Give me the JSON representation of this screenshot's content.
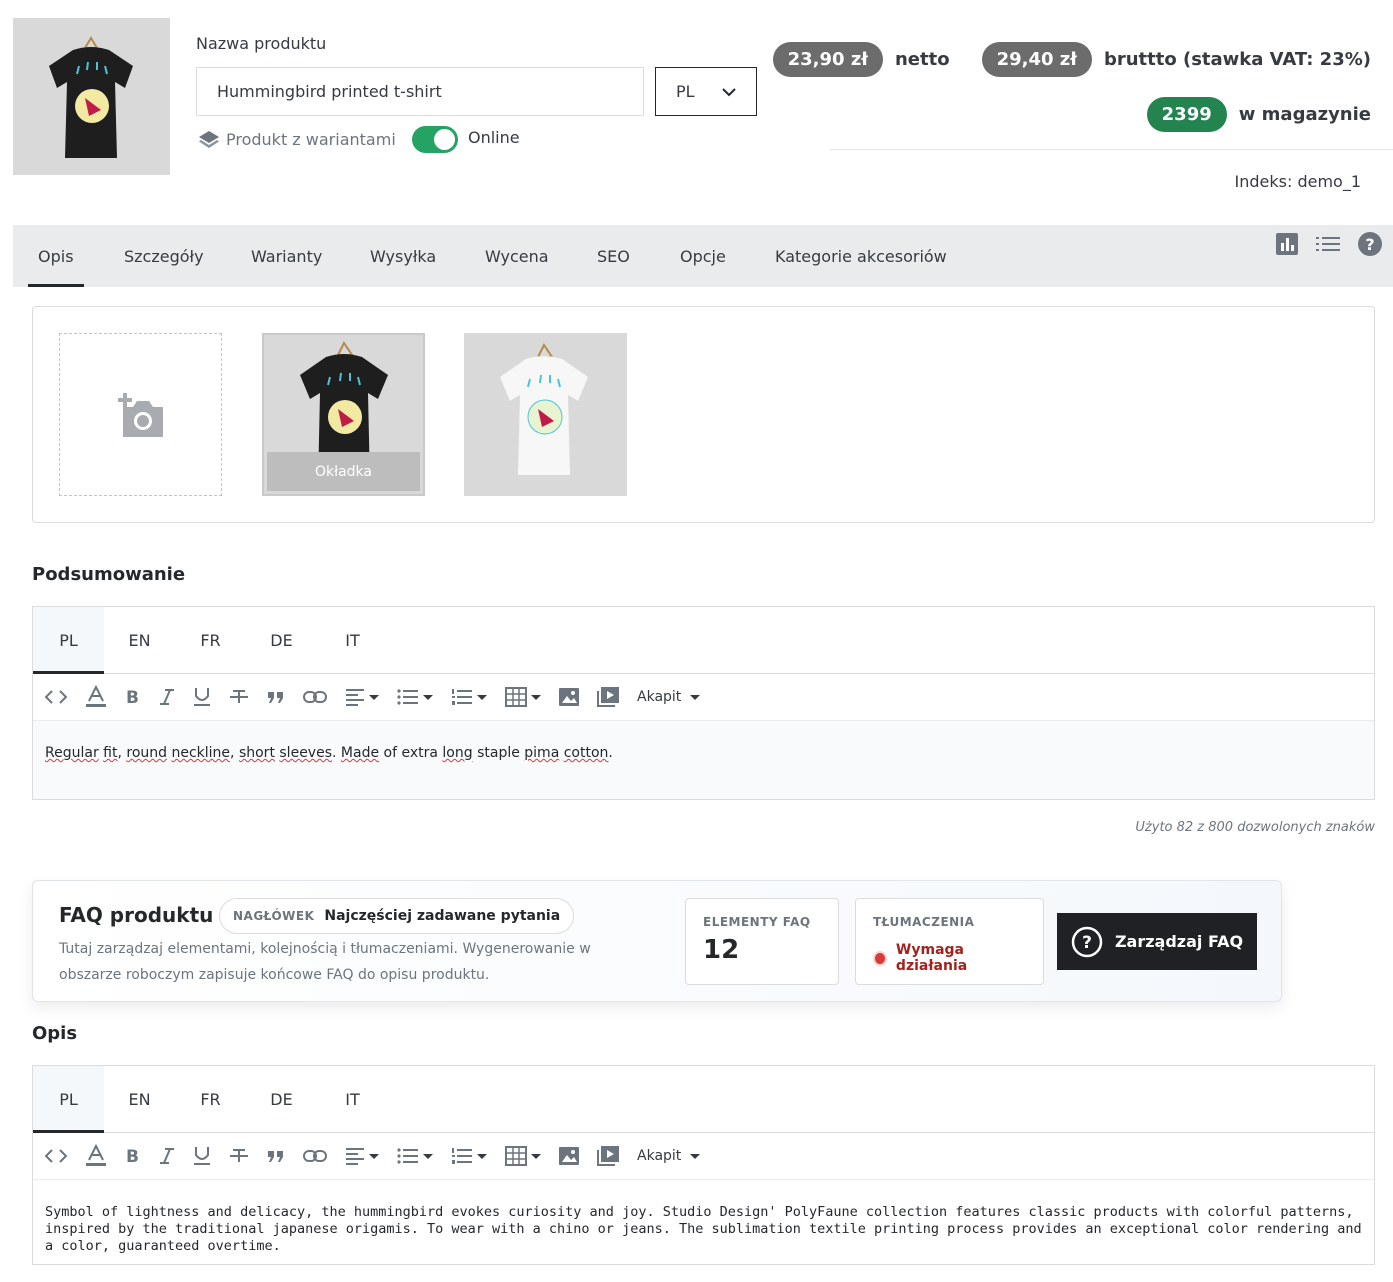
{
  "product": {
    "name_label": "Nazwa produktu",
    "name_value": "Hummingbird printed t-shirt",
    "language": "PL",
    "variants_label": "Produkt z wariantami",
    "online_label": "Online",
    "online": true
  },
  "pricing": {
    "net_price": "23,90 zł",
    "net_label": "netto",
    "gross_price": "29,40 zł",
    "gross_label": "bruttto (stawka VAT: 23%)",
    "stock": "2399",
    "stock_label": "w magazynie",
    "index": "Indeks: demo_1",
    "colors": {
      "pill": "#6c6c6c",
      "stock_pill": "#24844f"
    }
  },
  "tabs": [
    {
      "label": "Opis",
      "active": true
    },
    {
      "label": "Szczegóły"
    },
    {
      "label": "Warianty"
    },
    {
      "label": "Wysyłka"
    },
    {
      "label": "Wycena"
    },
    {
      "label": "SEO"
    },
    {
      "label": "Opcje"
    },
    {
      "label": "Kategorie akcesoriów"
    }
  ],
  "tab_icons": [
    "chart-icon",
    "list-icon",
    "help-icon"
  ],
  "images": {
    "cover_label": "Okładka",
    "items": [
      "black-tshirt",
      "white-tshirt"
    ]
  },
  "summary": {
    "title": "Podsumowanie",
    "languages": [
      "PL",
      "EN",
      "FR",
      "DE",
      "IT"
    ],
    "active_language": "PL",
    "paragraph_style": "Akapit",
    "content": "Regular fit, round neckline, short sleeves. Made of extra long staple pima cotton.",
    "counter": "Użyto 82 z 800 dozwolonych znaków"
  },
  "faq": {
    "title": "FAQ produktu",
    "badge_key": "NAGŁÓWEK",
    "badge_value": "Najczęściej zadawane pytania",
    "description": "Tutaj zarządzaj elementami, kolejnością i tłumaczeniami. Wygenerowanie w obszarze roboczym zapisuje końcowe FAQ do opisu produktu.",
    "elements_label": "ELEMENTY FAQ",
    "elements_count": "12",
    "translations_label": "TŁUMACZENIA",
    "translations_status": "Wymaga działania",
    "manage_button": "Zarządzaj FAQ"
  },
  "description": {
    "title": "Opis",
    "languages": [
      "PL",
      "EN",
      "FR",
      "DE",
      "IT"
    ],
    "active_language": "PL",
    "paragraph_style": "Akapit",
    "content": "Symbol of lightness and delicacy, the hummingbird evokes curiosity and joy. Studio Design' PolyFaune collection features classic products with colorful patterns, inspired by the traditional japanese origamis. To wear with a chino or jeans. The sublimation textile printing process provides an exceptional color rendering and a color, guaranteed overtime."
  }
}
